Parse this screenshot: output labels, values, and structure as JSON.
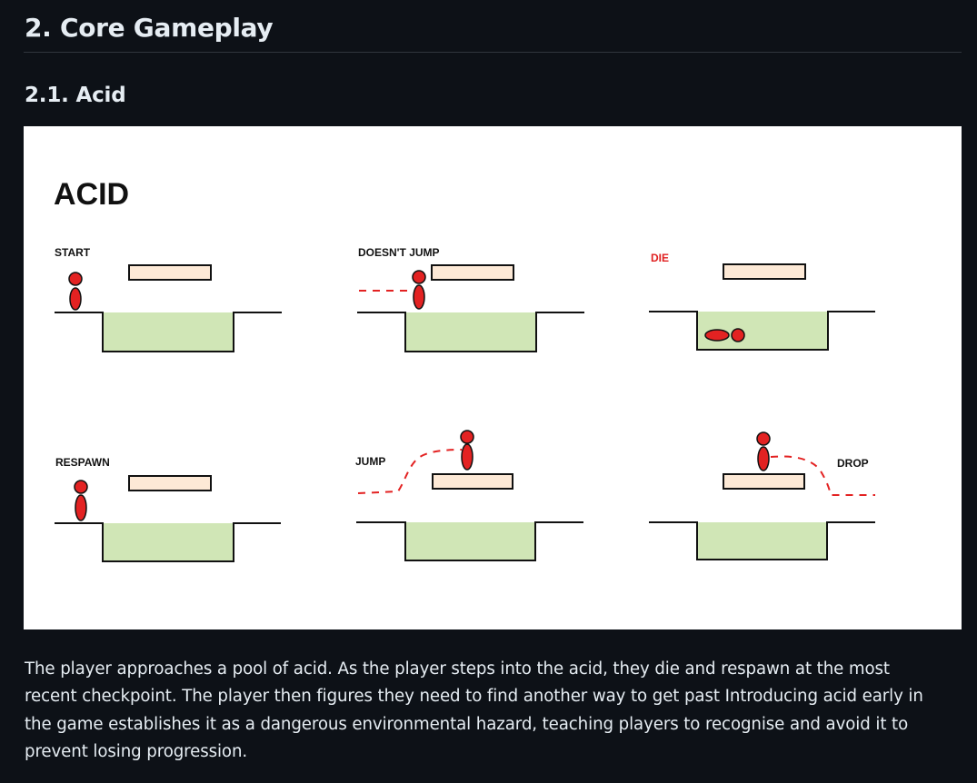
{
  "section": {
    "heading": "2. Core Gameplay"
  },
  "subsection": {
    "heading": "2.1. Acid"
  },
  "figure": {
    "title": "ACID",
    "panels": [
      {
        "label": "START"
      },
      {
        "label": "DOESN'T JUMP"
      },
      {
        "label": "DIE"
      },
      {
        "label": "RESPAWN"
      },
      {
        "label": "JUMP"
      },
      {
        "label": "DROP"
      }
    ],
    "colors": {
      "acid": "#d0e6b6",
      "platform": "#fde9d6",
      "player": "#e32222",
      "path": "#e32222",
      "outline": "#111111"
    }
  },
  "paragraph": {
    "text": "The player approaches a pool of acid. As the player steps into the acid, they die and respawn at the most recent checkpoint. The player then figures they need to find another way to get past Introducing acid early in the game establishes it as a dangerous environmental hazard, teaching players to recognise and avoid it to prevent losing progression."
  }
}
